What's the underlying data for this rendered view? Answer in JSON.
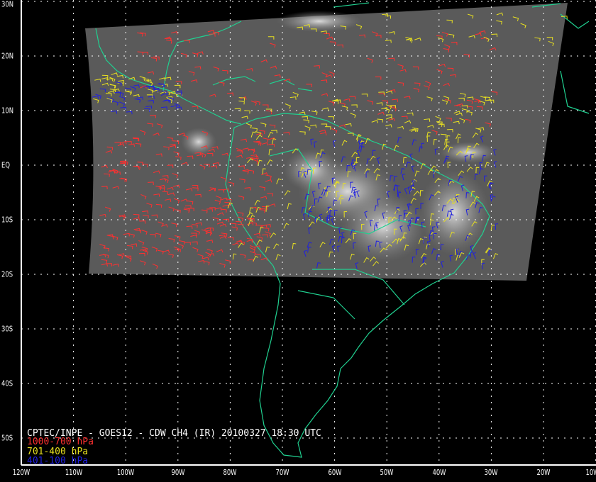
{
  "map": {
    "title": "CPTEC/INPE - GOES12 - CDW CH4 (IR) 20100327 18:30 UTC",
    "legend": [
      {
        "label": "1000-700 hPa",
        "color": "#ff3030"
      },
      {
        "label": "701-400 hPa",
        "color": "#e8e020"
      },
      {
        "label": "401-100 hPa",
        "color": "#2020e0"
      }
    ],
    "x_ticks": [
      "120W",
      "110W",
      "100W",
      "90W",
      "80W",
      "70W",
      "60W",
      "50W",
      "40W",
      "30W",
      "20W",
      "10W"
    ],
    "y_ticks": [
      "30N",
      "20N",
      "10N",
      "EQ",
      "10S",
      "20S",
      "30S",
      "40S",
      "50S"
    ],
    "coast_color": "#20d090",
    "grid_color": "#ffffff"
  }
}
